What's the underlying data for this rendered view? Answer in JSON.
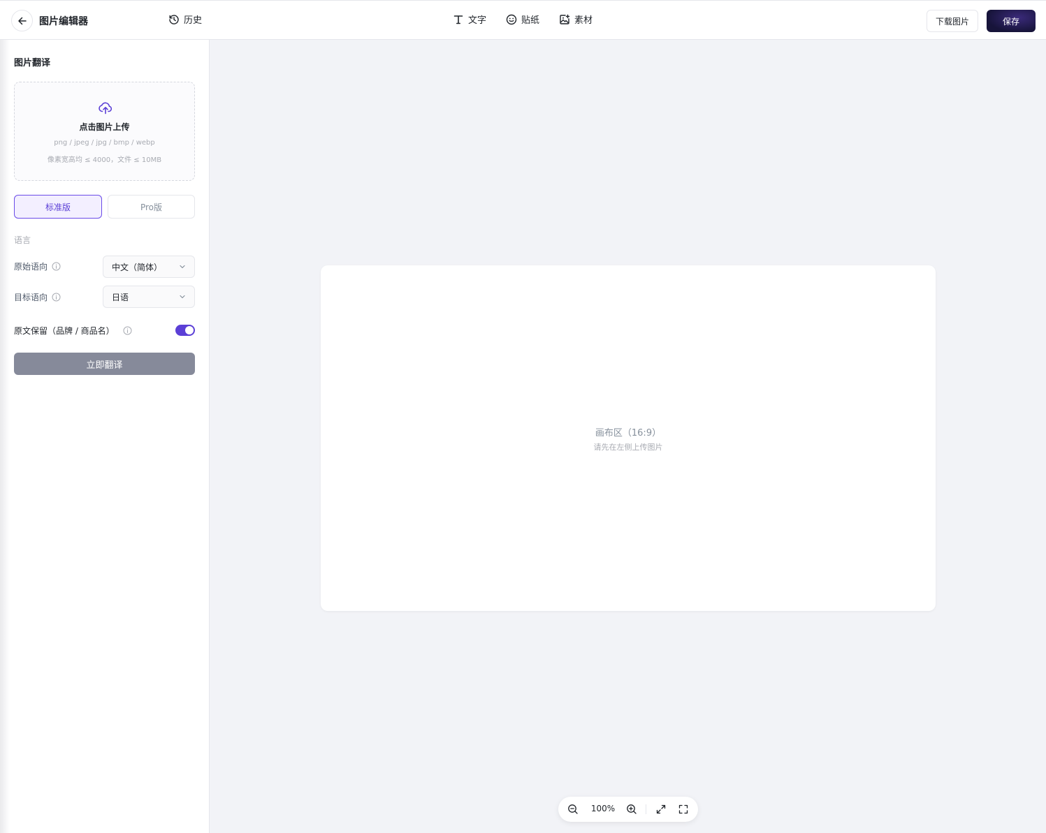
{
  "header": {
    "back_icon": "arrow-left-icon",
    "title": "图片编辑器",
    "history": {
      "icon": "history-icon",
      "label": "历史"
    },
    "tools": [
      {
        "icon": "text-icon",
        "label": "文字"
      },
      {
        "icon": "sticker-icon",
        "label": "贴纸"
      },
      {
        "icon": "material-icon",
        "label": "素材"
      }
    ],
    "download_label": "下载图片",
    "save_label": "保存"
  },
  "sidebar": {
    "title": "图片翻译",
    "upload": {
      "icon": "cloud-upload-icon",
      "label": "点击图片上传",
      "formats": "png / jpeg / jpg / bmp / webp",
      "limits": "像素宽高均 ≤ 4000，文件 ≤ 10MB"
    },
    "versions": {
      "standard": "标准版",
      "pro": "Pro版",
      "selected": "标准版"
    },
    "language_section": "语言",
    "source_language": {
      "label": "原始语向",
      "value": "中文（简体）"
    },
    "target_language": {
      "label": "目标语向",
      "value": "日语"
    },
    "keep_original": {
      "label": "原文保留（品牌 / 商品名）",
      "enabled": true
    },
    "translate_button": "立即翻译"
  },
  "canvas": {
    "title": "画布区（16:9）",
    "hint": "请先在左侧上传图片"
  },
  "zoom": {
    "level": "100%",
    "icons": [
      "zoom-out-icon",
      "zoom-in-icon",
      "fit-icon",
      "fullscreen-icon"
    ]
  },
  "colors": {
    "accent": "#5b3fd6",
    "save_button": "#17143a",
    "translate_button_disabled": "#868a9a",
    "canvas_background": "#f2f3f7"
  }
}
